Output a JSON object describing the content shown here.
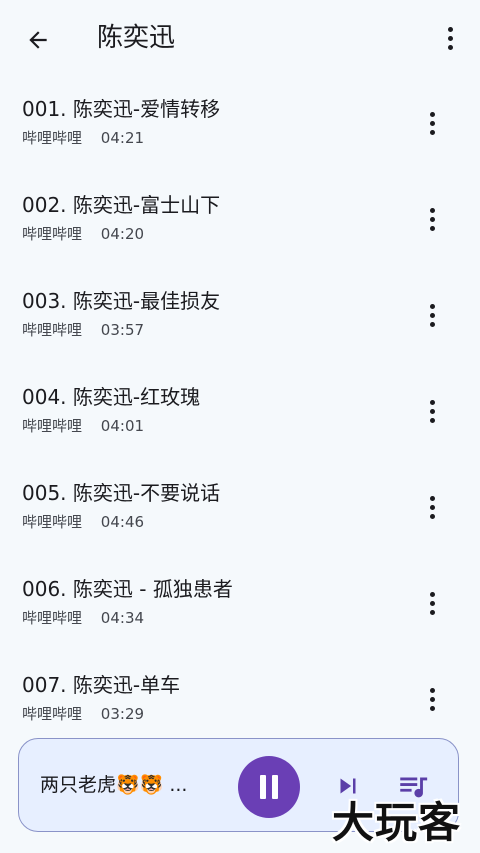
{
  "header": {
    "title": "陈奕迅",
    "back_icon": "arrow-left-icon",
    "more_icon": "more-vertical-icon"
  },
  "songs": [
    {
      "title": "001. 陈奕迅-爱情转移",
      "artist": "哔哩哔哩",
      "duration": "04:21"
    },
    {
      "title": "002. 陈奕迅-富士山下",
      "artist": "哔哩哔哩",
      "duration": "04:20"
    },
    {
      "title": "003. 陈奕迅-最佳损友",
      "artist": "哔哩哔哩",
      "duration": "03:57"
    },
    {
      "title": "004. 陈奕迅-红玫瑰",
      "artist": "哔哩哔哩",
      "duration": "04:01"
    },
    {
      "title": "005. 陈奕迅-不要说话",
      "artist": "哔哩哔哩",
      "duration": "04:46"
    },
    {
      "title": "006. 陈奕迅 - 孤独患者",
      "artist": "哔哩哔哩",
      "duration": "04:34"
    },
    {
      "title": "007. 陈奕迅-单车",
      "artist": "哔哩哔哩",
      "duration": "03:29"
    }
  ],
  "player": {
    "now_playing": "两只老虎🐯🐯 ...",
    "state": "playing",
    "play_pause_icon": "pause-icon",
    "next_icon": "skip-next-icon",
    "queue_icon": "queue-music-icon"
  },
  "watermark": {
    "text": "大玩客"
  },
  "colors": {
    "background": "#f5f9fc",
    "player_background": "#e7efff",
    "player_border": "#8a93c8",
    "accent": "#6a3fb5",
    "icon_accent": "#5b3fa8",
    "text_primary": "#1b1b1f",
    "text_secondary": "#44474e"
  }
}
